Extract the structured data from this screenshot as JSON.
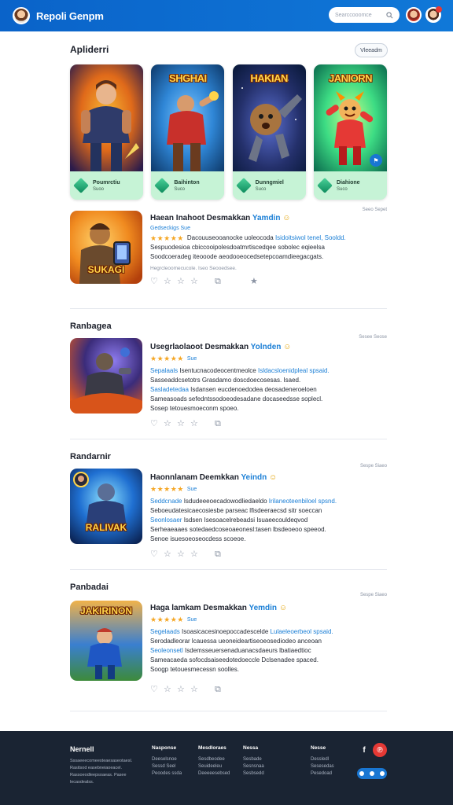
{
  "header": {
    "brand": "Repoli Genpm",
    "search_placeholder": "Searccooomce"
  },
  "featured": {
    "title": "Apliderri",
    "view_all_label": "Vleeadm",
    "cards": [
      {
        "art_title": "",
        "name": "Poumrctiu",
        "sub": "Suoo",
        "palette": [
          "#2b1b4a",
          "#e06a1a",
          "#f7b733"
        ]
      },
      {
        "art_title": "SHGHAI",
        "name": "Baihinton",
        "sub": "Suco",
        "palette": [
          "#0e3a6b",
          "#2f86d6",
          "#e23c2f"
        ]
      },
      {
        "art_title": "HAKIAN",
        "name": "Dunngmiel",
        "sub": "Suco",
        "palette": [
          "#0b1a3d",
          "#3b4fa3",
          "#e98a2a"
        ]
      },
      {
        "art_title": "JANIORN",
        "name": "Diahione",
        "sub": "Suco",
        "palette": [
          "#0b6b4e",
          "#3ddc84",
          "#e53935"
        ]
      }
    ]
  },
  "items": [
    {
      "section": "",
      "thumb_title": "SUKAGI",
      "name_main": "Haean Inahoot Desmakkan",
      "name_accent": "Yamdin",
      "rating_text": "Gedseckigs Sue",
      "desc_lines": [
        [
          "",
          "Dacouuseooanocke uoleocoda ",
          "Isidoitsiwol tenel, ",
          "Sooldd."
        ],
        [
          "",
          "Sespuodesioa cbiccooipolesdoatmrtiscedqee sobolec eqieelsa",
          "",
          ""
        ],
        [
          "",
          "Soodcoeradeg iteooode aeodooeocedsetepcoamdieegacgats.",
          "",
          ""
        ]
      ],
      "sub": "Hegrcleoomecucole. Iseo Seooedsee.",
      "date": "Seeo Sepet"
    },
    {
      "section": "Ranbagea",
      "thumb_title": "",
      "name_main": "Usegrlaolaoot Desmakkan",
      "name_accent": "Yolnden",
      "rating_text": "Sue",
      "desc_lines": [
        [
          "Sepalaals ",
          "Isentucnacodeocentmeolce ",
          "Isldacsloenidpleal ",
          "spsaid."
        ],
        [
          "",
          "Sasseaddcsetotrs Grasdamo doscdoecosesas. Isaed.",
          "",
          ""
        ],
        [
          "Sasladetedaa ",
          "Isdansen eucdenoedodea deosadeneroeloen",
          "",
          ""
        ],
        [
          "",
          "Sameasoads sefedntssodoeodesadane docaseedsse soplecl.",
          "",
          ""
        ],
        [
          "",
          "Sosep tetouesmoeconm spoeo.",
          "",
          ""
        ]
      ],
      "sub": "",
      "date": "Sesee Seose"
    },
    {
      "section": "Randarnir",
      "thumb_title": "RALIVAK",
      "name_main": "Haonnlanam Deemkkan",
      "name_accent": "Yeindn",
      "rating_text": "Sue",
      "desc_lines": [
        [
          "Seddcnade ",
          "Isdudeeeoecadowodliedaeldo ",
          "Irilaneoteenbiloel ",
          "spsnd."
        ],
        [
          "",
          "Seboeudatesicaecosiesbe parseac lfisdeeraecsd sitr soeccan",
          "",
          ""
        ],
        [
          "Seonlosaer ",
          "Isdsen Isesoacelrebeadsi Isuaeecouldeqvod",
          "",
          ""
        ],
        [
          "",
          "Serheaeaaes sotedaedcoseoaeonesl:tasen lbsdeoeoo speeod.",
          "",
          ""
        ],
        [
          "",
          "Senoe isuesoeoseocdess scoeoe.",
          "",
          ""
        ]
      ],
      "sub": "",
      "date": "Sespe Siaeo"
    },
    {
      "section": "Panbadai",
      "thumb_title": "JAKIRINON",
      "name_main": "Haga lamkam Desmakkan",
      "name_accent": "Yemdin",
      "rating_text": "Sue",
      "desc_lines": [
        [
          "Segelaads ",
          "Isoasicacesinoepoccadescelde ",
          "Lulaeleoerbeol ",
          "spsaid."
        ],
        [
          "",
          "Serodadleorar lcauessa ueoneideartiseoeosediodeo anceoan",
          "",
          ""
        ],
        [
          "Seoleonsetl ",
          "Isdemsseuersenaduanacsdaeurs lbatiaedtioc",
          "",
          ""
        ],
        [
          "",
          "Sameacaeda sofocdsaiseedotedoeccle Dclsenadee spaced.",
          "",
          ""
        ],
        [
          "",
          "Soogp tetouesmecessn soolles.",
          "",
          ""
        ]
      ],
      "sub": "",
      "date": "Sespe Siaeo"
    }
  ],
  "footer": {
    "title": "Nernell",
    "about": "Sssaeeecomeesteaesaseotaesl. Rasitsod easebneiaoeacel. Rassoeodleepsoaeas. Pasee lecasdealss.",
    "cols": [
      {
        "heading": "Nasponse",
        "links": [
          "Deeselsnoe",
          "Sessd Seel",
          "Peoodes ssda"
        ]
      },
      {
        "heading": "Mesdloraes",
        "links": [
          "Sesdbeodee",
          "Seuideeleu",
          "Deeeeesebsed"
        ]
      },
      {
        "heading": "Nessa",
        "links": [
          "Sesbade",
          "Sesnsnaa",
          "Sesbsedd"
        ]
      },
      {
        "heading": "Nesse",
        "links": [
          "Dessledl",
          "Sesesedas",
          "Pesedoad"
        ]
      }
    ]
  },
  "colors": {
    "brand": "#0a63c9",
    "accent": "#1b7fd6",
    "star": "#f5a623",
    "card_footer": "#c6f3d6"
  }
}
